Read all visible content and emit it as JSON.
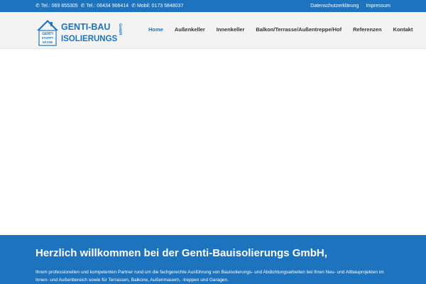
{
  "topbar": {
    "contacts": [
      {
        "icon": "phone-icon",
        "label": "Tel.: 069 855305"
      },
      {
        "icon": "phone-icon",
        "label": "Tel.: 06434 906414"
      },
      {
        "icon": "phone-icon",
        "label": "Mobil: 0173 5848037"
      }
    ],
    "links": [
      "Datenschutzerklärung",
      "Impressum"
    ]
  },
  "logo": {
    "line1": "GENTI-BAU",
    "line2": "ISOLIERUNGS",
    "suffix": "GmbH",
    "badge": [
      "GENTI",
      "STOPPT",
      "NÄSSE"
    ]
  },
  "nav": {
    "items": [
      "Home",
      "Außenkeller",
      "Innenkeller",
      "Balkon/Terrasse/Außentreppe/Hof",
      "Referenzen",
      "Kontakt"
    ],
    "active": "Home"
  },
  "welcome": {
    "title": "Herzlich willkommen bei der Genti-Bauisolierungs GmbH,",
    "text": "Ihrem professionellen und kompetenten Partner rund um die fachgerechte Ausführung von Bauisolierungs- und Abdichtungsarbeiten bei Ihren Neu- und Altbauprojekten im Innen- und Außenbereich sowie für Terrassen, Balkone, Außenmauern, -treppen und Garagen."
  },
  "colors": {
    "brand": "#1e73be",
    "header_bg": "#f3f3f3",
    "nav_text": "#333333"
  }
}
